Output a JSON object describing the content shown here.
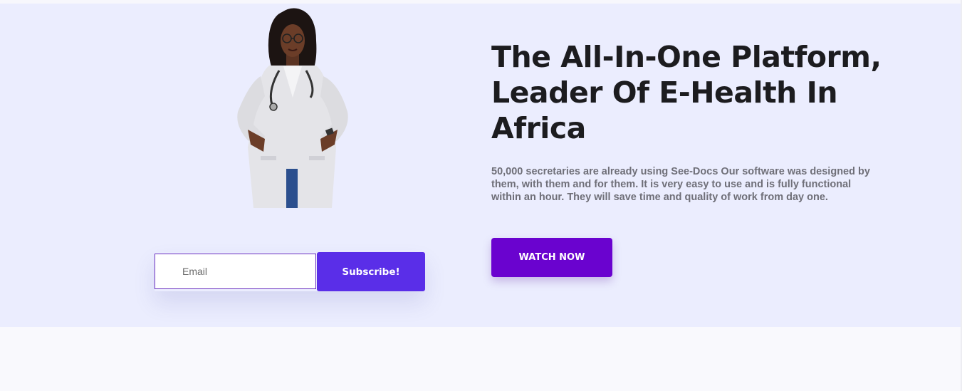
{
  "hero": {
    "headline": "The All-In-One Platform, Leader Of E-Health In Africa",
    "description": "50,000 secretaries are already using See-Docs Our software was designed by them, with them and for them. It is very easy to use and is fully functional within an hour. They will save time and quality of work from day one.",
    "watch_label": "WATCH NOW",
    "image_icon": "doctor-illustration"
  },
  "subscribe": {
    "email_placeholder": "Email",
    "button_label": "Subscribe!"
  },
  "colors": {
    "hero_bg": "#ebedfe",
    "watch_button": "#6a03cf",
    "subscribe_button": "#5a2ee8"
  }
}
